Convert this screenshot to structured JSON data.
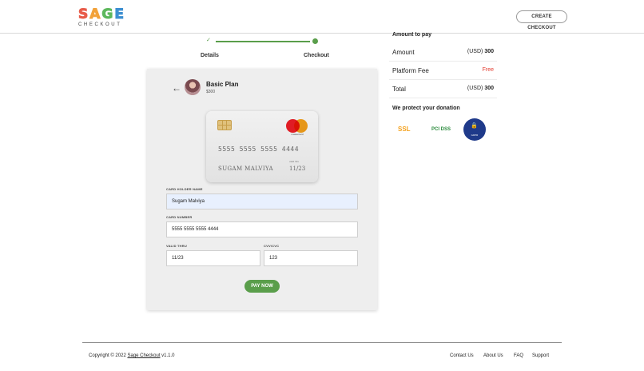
{
  "header": {
    "logo_main": "SAGE",
    "logo_sub": "CHECKOUT",
    "logo_colors": [
      "#e85c4a",
      "#f2a23a",
      "#5db85c",
      "#3d8fd1"
    ],
    "create_button": "CREATE CHECKOUT"
  },
  "stepper": {
    "steps": [
      "Details",
      "Checkout"
    ],
    "completed": "✓",
    "accent": "#5a9e4b"
  },
  "plan": {
    "back": "←",
    "title": "Basic Plan",
    "price": "$300"
  },
  "card": {
    "number": "5555 5555 5555 4444",
    "holder": "SUGAM MALVIYA",
    "valid_label": "valid thru",
    "expiry": "11/23",
    "brand": "mastercard"
  },
  "form": {
    "holder_label": "CARD HOLDER NAME",
    "holder_value": "Sugam Malviya",
    "number_label": "CARD NUMBER",
    "number_value": "5555 5555 5555 4444",
    "valid_label": "VALID THRU",
    "valid_value": "11/23",
    "cvv_label": "CVV/CVC",
    "cvv_value": "123",
    "pay_button": "PAY NOW"
  },
  "summary": {
    "title": "Amount to pay",
    "rows": [
      {
        "label": "Amount",
        "currency": "(USD)",
        "value": "300"
      },
      {
        "label": "Platform Fee",
        "value": "Free"
      },
      {
        "label": "Total",
        "currency": "(USD)",
        "value": "300"
      }
    ],
    "protect_title": "We protect your donation",
    "badges": [
      "SSL",
      "PCI DSS",
      "GDPR"
    ]
  },
  "footer": {
    "copyright_prefix": "Copyright © 2022",
    "brand_link": "Sage Checkout",
    "version": "v1.1.0",
    "links": [
      "Contact Us",
      "About Us",
      "FAQ",
      "Support"
    ]
  }
}
